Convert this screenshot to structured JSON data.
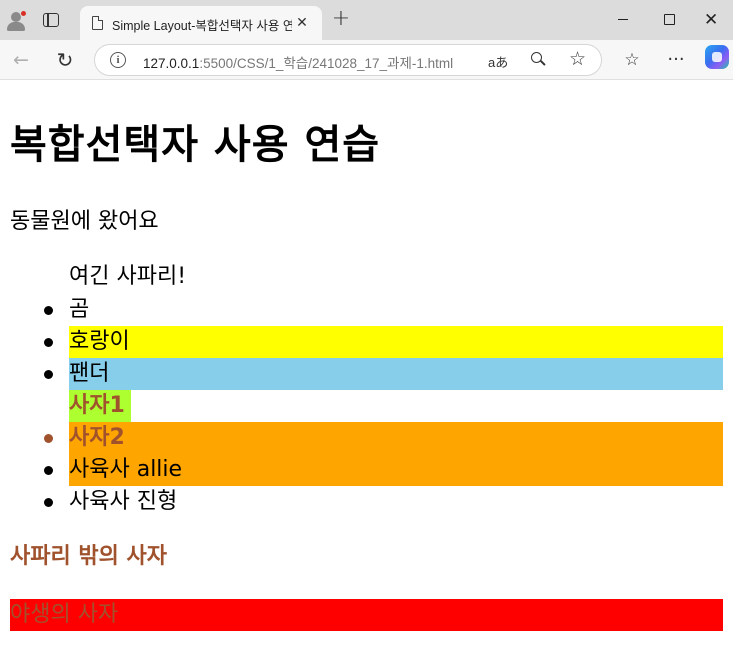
{
  "browser": {
    "tab_title": "Simple Layout-복합선택자 사용 연습",
    "tab_close_glyph": "✕",
    "new_tab_glyph": "+",
    "url_host": "127.0.0.1",
    "url_path": ":5500/CSS/1_학습/241028_17_과제-1.html",
    "read_aloud_label": "aあ",
    "window_close_glyph": "✕",
    "back_glyph": "←",
    "reload_glyph": "↻",
    "star_glyph": "☆",
    "favorites_glyph": "☆",
    "more_glyph": "···",
    "info_glyph": "i",
    "icons": [
      "profile-icon",
      "tab-actions-icon",
      "page-icon",
      "close-icon",
      "plus-icon",
      "minimize-icon",
      "maximize-icon",
      "back-icon",
      "reload-icon",
      "info-icon",
      "read-aloud-icon",
      "zoom-icon",
      "star-icon",
      "favorites-icon",
      "more-icon",
      "copilot-icon"
    ]
  },
  "page": {
    "heading": "복합선택자 사용 연습",
    "intro": "동물원에 왔어요",
    "list": {
      "safari": "여긴 사파리!",
      "bear": "곰",
      "tiger": "호랑이",
      "panda": "팬더",
      "lion1": "사자1",
      "lion2": "사자2",
      "keeper1": "사육사 allie",
      "keeper2": "사육사 진형"
    },
    "subheading": "사파리 밖의 사자",
    "wild": "야생의 사자"
  },
  "colors": {
    "tiger_bg": "#ffff00",
    "panda_bg": "#87ceeb",
    "lion1_bg": "#adff2f",
    "lion_text": "#a0522d",
    "lion2_bg": "#ffa500",
    "keeper1_bg": "#ffa500",
    "wild_bg": "#ff0000"
  }
}
